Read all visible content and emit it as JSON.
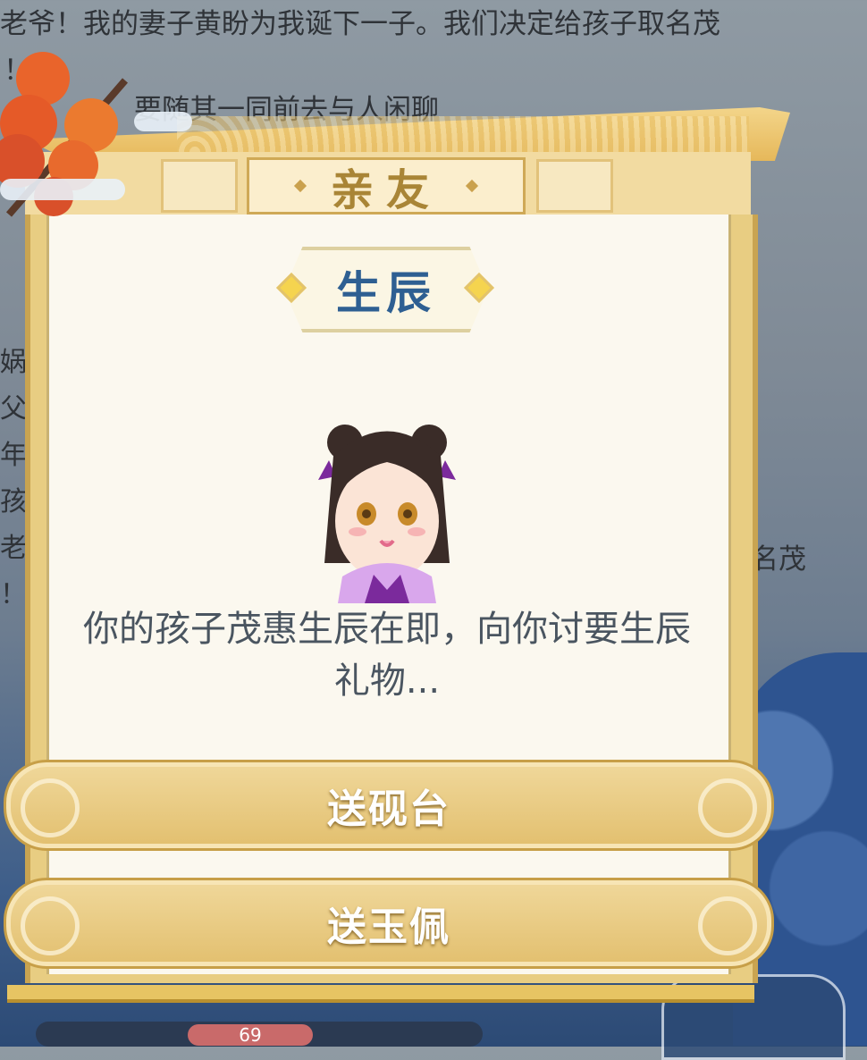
{
  "background_log": {
    "line1": "老爷！我的妻子黄盼为我诞下一子。我们决定给孩子取名茂",
    "line2": "！",
    "line3": "要随其一同前去与人闲聊",
    "left_fragments": [
      "娲",
      "父",
      "年",
      "孩",
      "老",
      "！"
    ],
    "right_fragment": "名茂",
    "bottom_number": "69"
  },
  "dialog": {
    "header_title": "亲友",
    "subtitle": "生辰",
    "message": "你的孩子茂惠生辰在即，向你讨要生辰礼物...",
    "choices": [
      {
        "label": "送砚台"
      },
      {
        "label": "送玉佩"
      }
    ]
  },
  "colors": {
    "gold_frame": "#e8cd82",
    "panel_bg": "#fbf8ef",
    "title_brown": "#a98536",
    "subtitle_blue": "#2e5f92",
    "message_gray": "#4a5560"
  },
  "icons": {
    "portrait": "child-avatar-icon",
    "decoration": "tanghulu-icon"
  }
}
